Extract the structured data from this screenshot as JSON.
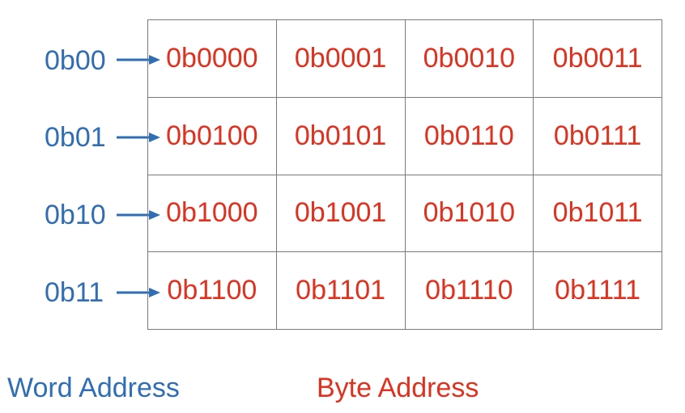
{
  "colors": {
    "word": "#2f6db5",
    "byte": "#e0301e",
    "grid": "#7a7a7a"
  },
  "word_addresses": [
    "0b00",
    "0b01",
    "0b10",
    "0b11"
  ],
  "byte_addresses": [
    [
      "0b0000",
      "0b0001",
      "0b0010",
      "0b0011"
    ],
    [
      "0b0100",
      "0b0101",
      "0b0110",
      "0b0111"
    ],
    [
      "0b1000",
      "0b1001",
      "0b1010",
      "0b1011"
    ],
    [
      "0b1100",
      "0b1101",
      "0b1110",
      "0b1111"
    ]
  ],
  "legend": {
    "word_label": "Word Address",
    "byte_label": "Byte Address"
  }
}
